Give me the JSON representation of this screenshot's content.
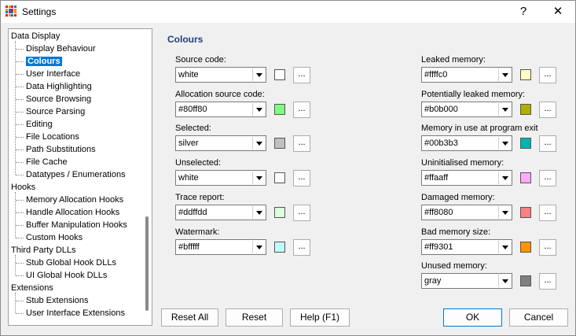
{
  "window": {
    "title": "Settings",
    "help_label": "?",
    "close_label": "✕",
    "icon": "grid-app-icon"
  },
  "tree": {
    "items": [
      {
        "label": "Data Display",
        "level": 0
      },
      {
        "label": "Display Behaviour",
        "level": 1
      },
      {
        "label": "Colours",
        "level": 1,
        "selected": true
      },
      {
        "label": "User Interface",
        "level": 1
      },
      {
        "label": "Data Highlighting",
        "level": 1
      },
      {
        "label": "Source Browsing",
        "level": 1
      },
      {
        "label": "Source Parsing",
        "level": 1
      },
      {
        "label": "Editing",
        "level": 1
      },
      {
        "label": "File Locations",
        "level": 1
      },
      {
        "label": "Path Substitutions",
        "level": 1
      },
      {
        "label": "File Cache",
        "level": 1
      },
      {
        "label": "Datatypes / Enumerations",
        "level": 1
      },
      {
        "label": "Hooks",
        "level": 0
      },
      {
        "label": "Memory Allocation Hooks",
        "level": 1
      },
      {
        "label": "Handle Allocation Hooks",
        "level": 1
      },
      {
        "label": "Buffer Manipulation Hooks",
        "level": 1
      },
      {
        "label": "Custom Hooks",
        "level": 1
      },
      {
        "label": "Third Party DLLs",
        "level": 0
      },
      {
        "label": "Stub Global Hook DLLs",
        "level": 1
      },
      {
        "label": "UI Global Hook DLLs",
        "level": 1
      },
      {
        "label": "Extensions",
        "level": 0
      },
      {
        "label": "Stub Extensions",
        "level": 1
      },
      {
        "label": "User Interface Extensions",
        "level": 1
      }
    ]
  },
  "colours": {
    "title": "Colours",
    "left": [
      {
        "label": "Source code:",
        "value": "white",
        "swatch": "#ffffff"
      },
      {
        "label": "Allocation source code:",
        "value": "#80ff80",
        "swatch": "#80ff80"
      },
      {
        "label": "Selected:",
        "value": "silver",
        "swatch": "#c0c0c0"
      },
      {
        "label": "Unselected:",
        "value": "white",
        "swatch": "#ffffff"
      },
      {
        "label": "Trace report:",
        "value": "#ddffdd",
        "swatch": "#ddffdd"
      },
      {
        "label": "Watermark:",
        "value": "#bfffff",
        "swatch": "#bfffff"
      }
    ],
    "right": [
      {
        "label": "Leaked memory:",
        "value": "#ffffc0",
        "swatch": "#ffffc0"
      },
      {
        "label": "Potentially leaked memory:",
        "value": "#b0b000",
        "swatch": "#b0b000"
      },
      {
        "label": "Memory in use at program exit",
        "value": "#00b3b3",
        "swatch": "#00b3b3"
      },
      {
        "label": "Uninitialised memory:",
        "value": "#ffaaff",
        "swatch": "#ffaaff"
      },
      {
        "label": "Damaged memory:",
        "value": "#ff8080",
        "swatch": "#ff8080"
      },
      {
        "label": "Bad memory size:",
        "value": "#ff9301",
        "swatch": "#ff9301"
      },
      {
        "label": "Unused memory:",
        "value": "gray",
        "swatch": "#808080"
      }
    ],
    "dots_label": "..."
  },
  "buttons": {
    "reset_all": "Reset All",
    "reset": "Reset",
    "help": "Help (F1)",
    "ok": "OK",
    "cancel": "Cancel"
  }
}
